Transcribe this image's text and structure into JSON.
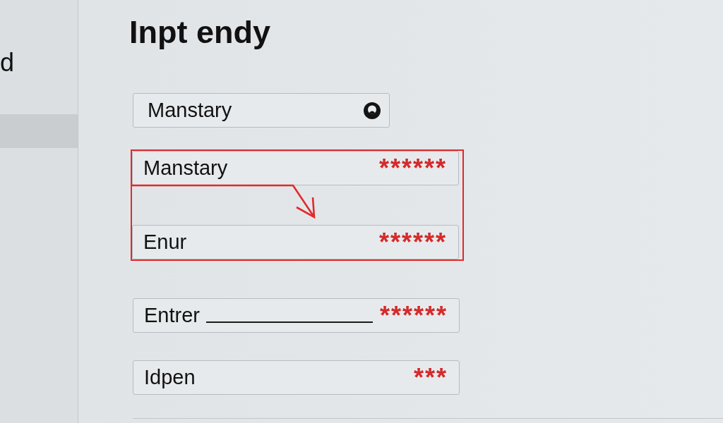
{
  "sidebar": {
    "items": [
      {
        "label": "d",
        "selected": false
      },
      {
        "selected": true
      }
    ]
  },
  "title": "Inpt endy",
  "form": [
    {
      "kind": "picker",
      "value": "Manstary"
    },
    {
      "kind": "callout",
      "arrow": true,
      "fields": [
        {
          "kind": "text",
          "value": "Manstary",
          "marker": "******"
        },
        {
          "kind": "text",
          "value": "Enur",
          "marker": "******"
        }
      ]
    },
    {
      "kind": "blank",
      "value": "Entrer",
      "marker": "******"
    },
    {
      "kind": "text",
      "value": "Idpen",
      "marker": "***"
    }
  ]
}
